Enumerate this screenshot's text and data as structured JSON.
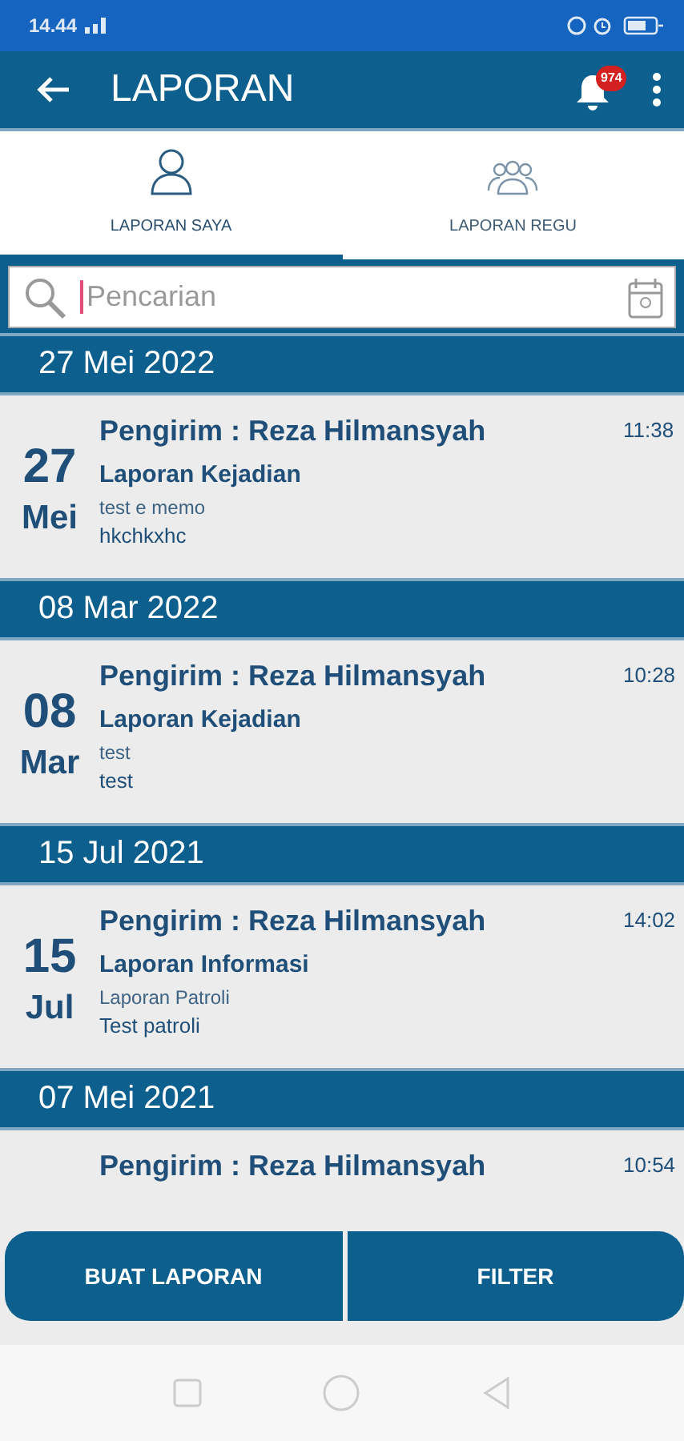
{
  "status_bar": {
    "time": "14.44"
  },
  "app_bar": {
    "title": "LAPORAN",
    "notification_count": "974"
  },
  "tabs": [
    {
      "label": "LAPORAN SAYA",
      "kind": "person",
      "selected": true
    },
    {
      "label": "LAPORAN REGU",
      "kind": "group",
      "selected": false
    }
  ],
  "search": {
    "placeholder": "Pencarian"
  },
  "reports": [
    {
      "date_header": "27 Mei 2022",
      "day": "27",
      "month": "Mei",
      "sender": "Pengirim : Reza  Hilmansyah",
      "time": "11:38",
      "title": "Laporan Kejadian",
      "subtitle": "test e memo",
      "body": "hkchkxhc"
    },
    {
      "date_header": "08 Mar 2022",
      "day": "08",
      "month": "Mar",
      "sender": "Pengirim : Reza  Hilmansyah",
      "time": "10:28",
      "title": "Laporan Kejadian",
      "subtitle": "test",
      "body": "test"
    },
    {
      "date_header": "15 Jul 2021",
      "day": "15",
      "month": "Jul",
      "sender": "Pengirim : Reza  Hilmansyah",
      "time": "14:02",
      "title": "Laporan Informasi",
      "subtitle": "Laporan Patroli",
      "body": "Test patroli"
    },
    {
      "date_header": "07 Mei 2021",
      "sender": "Pengirim : Reza  Hilmansyah",
      "time": "10:54"
    }
  ],
  "actions": [
    "BUAT LAPORAN",
    "FILTER"
  ]
}
